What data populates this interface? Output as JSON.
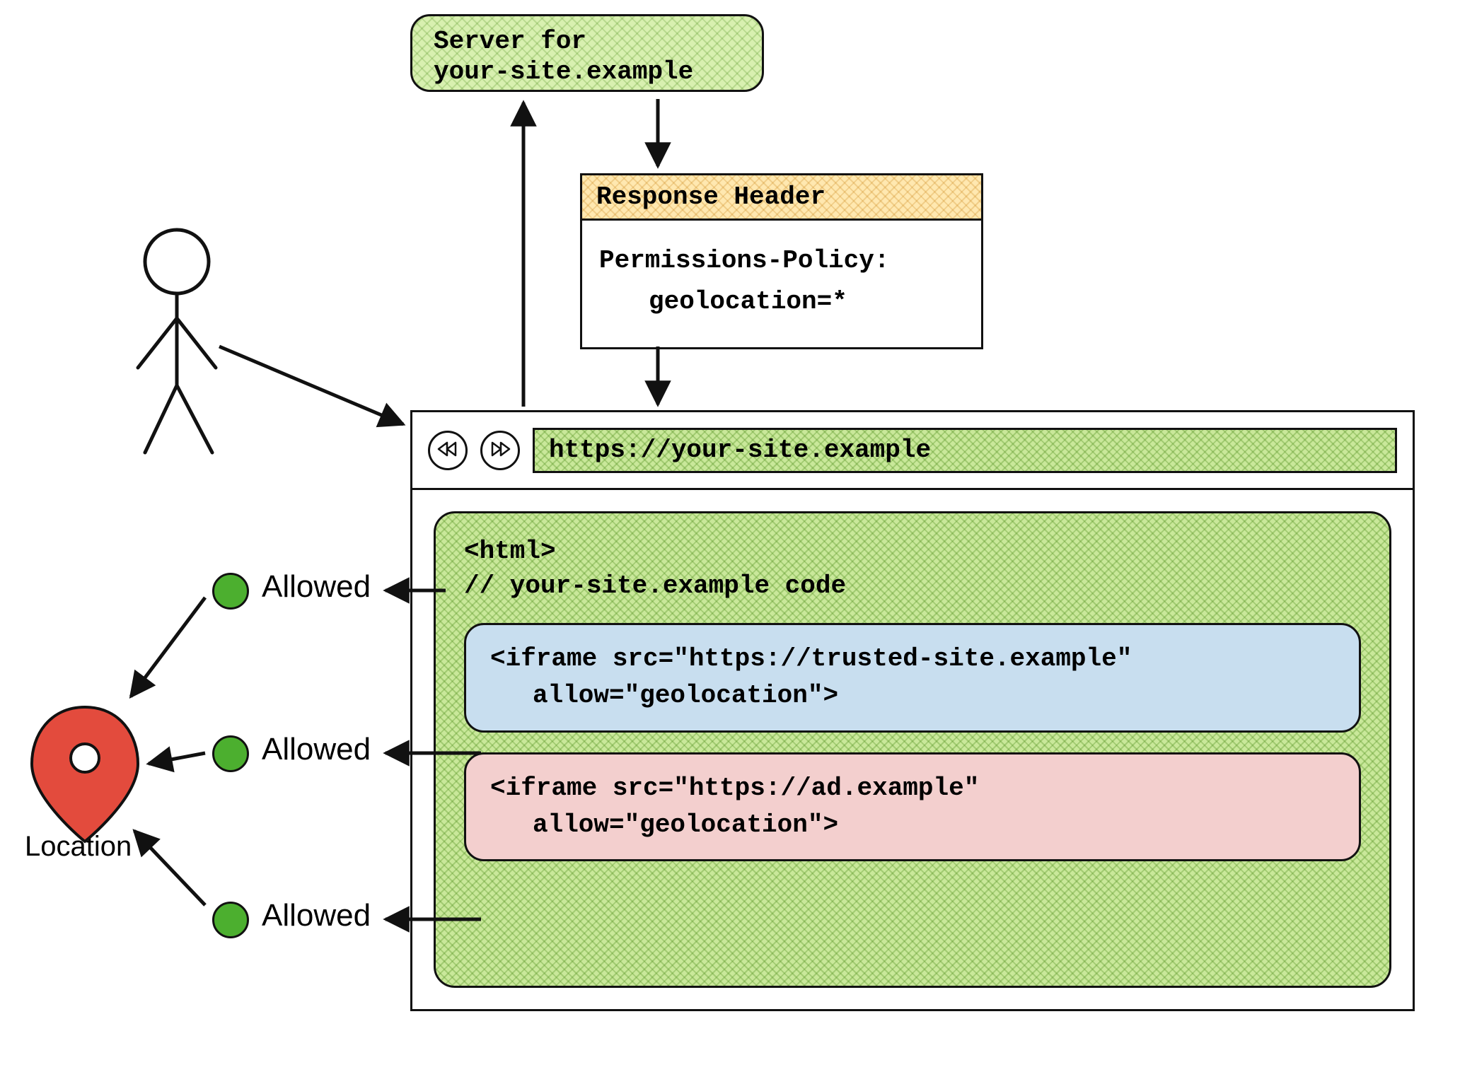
{
  "server": {
    "line1": "Server for",
    "line2": "your-site.example"
  },
  "response_header": {
    "title": "Response Header",
    "line1": "Permissions-Policy:",
    "line2": "geolocation=*"
  },
  "browser": {
    "back_icon": "rewind-icon",
    "forward_icon": "fast-forward-icon",
    "url": "https://your-site.example"
  },
  "page_code": {
    "line1": "<html>",
    "line2": "// your-site.example code"
  },
  "iframe_trusted": {
    "line1": "<iframe src=\"https://trusted-site.example\"",
    "line2": "allow=\"geolocation\">"
  },
  "iframe_ad": {
    "line1": "<iframe src=\"https://ad.example\"",
    "line2": "allow=\"geolocation\">"
  },
  "statuses": {
    "s1": "Allowed",
    "s2": "Allowed",
    "s3": "Allowed"
  },
  "location_label": "Location",
  "colors": {
    "green_hatch": "#c9e89a",
    "orange_hatch": "#ffe8b0",
    "iframe_blue": "#c8deef",
    "iframe_pink": "#f3cfce",
    "dot_green": "#4caf2f",
    "pin_red": "#e34b3d"
  }
}
